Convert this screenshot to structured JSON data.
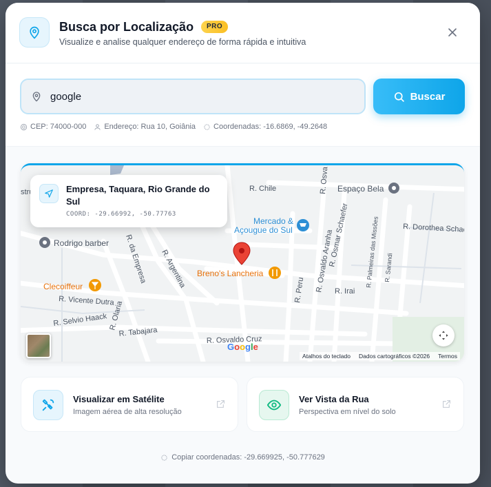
{
  "header": {
    "title": "Busca por Localização",
    "badge": "PRO",
    "subtitle": "Visualize e analise qualquer endereço de forma rápida e intuitiva"
  },
  "search": {
    "value": "google",
    "button_label": "Buscar"
  },
  "meta": {
    "cep": "CEP: 74000-000",
    "address": "Endereço: Rua 10, Goiânia",
    "coords": "Coordenadas: -16.6869, -49.2648"
  },
  "map": {
    "info_card": {
      "title": "Empresa, Taquara, Rio Grande do Sul",
      "coord": "COORD: -29.66992, -50.77763"
    },
    "street_labels": [
      "R. Chile",
      "R. da Empresa",
      "R. Argentina",
      "R. Olaria",
      "R. Vicente Dutra",
      "R. Selvio Haack",
      "R. Tabajara",
      "R. Osvaldo Cruz",
      "R. Peru",
      "R. Osvaldo Aranha",
      "R. Osmar Schaefer",
      "R. Irai",
      "R. Palmeiras das Missões",
      "R. Sarandi",
      "R. Dorothea Schae",
      "R. Osva",
      "stru"
    ],
    "pois": {
      "espaco_bela": "Espaço Bela",
      "mercado": "Mercado &\nAçougue do Sul",
      "rodrigo": "Rodrigo barber",
      "lancheria": "Breno's Lancheria",
      "clecoiffeur": "Clecoiffeur"
    },
    "google_logo": "Google",
    "footer": [
      "Atalhos do teclado",
      "Dados cartográficos ©2026",
      "Termos"
    ]
  },
  "actions": [
    {
      "title": "Visualizar em Satélite",
      "subtitle": "Imagem aérea de alta resolução"
    },
    {
      "title": "Ver Vista da Rua",
      "subtitle": "Perspectiva em nível do solo"
    }
  ],
  "copy_coords": "Copiar coordenadas: -29.669925, -50.777629",
  "colors": {
    "accent": "#0ea5e9",
    "badge": "#fbbf24",
    "street_view_green": "#10b981"
  }
}
